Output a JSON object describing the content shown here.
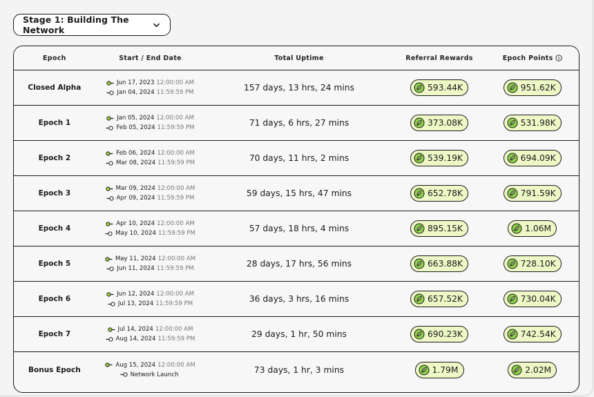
{
  "stage_selector": {
    "label": "Stage 1: Building The Network"
  },
  "table": {
    "headers": {
      "epoch": "Epoch",
      "dates": "Start / End Date",
      "uptime": "Total Uptime",
      "referral": "Referral Rewards",
      "points": "Epoch Points"
    },
    "rows": [
      {
        "epoch": "Closed Alpha",
        "start_date": "Jun 17, 2023",
        "start_time": "12:00:00 AM",
        "end_date": "Jan 04, 2024",
        "end_time": "11:59:59 PM",
        "uptime": "157 days, 13 hrs, 24 mins",
        "referral": "593.44K",
        "points": "951.62K"
      },
      {
        "epoch": "Epoch 1",
        "start_date": "Jan 05, 2024",
        "start_time": "12:00:00 AM",
        "end_date": "Feb 05, 2024",
        "end_time": "11:59:59 PM",
        "uptime": "71 days, 6 hrs, 27 mins",
        "referral": "373.08K",
        "points": "531.98K"
      },
      {
        "epoch": "Epoch 2",
        "start_date": "Feb 06, 2024",
        "start_time": "12:00:00 AM",
        "end_date": "Mar 08, 2024",
        "end_time": "11:59:59 PM",
        "uptime": "70 days, 11 hrs, 2 mins",
        "referral": "539.19K",
        "points": "694.09K"
      },
      {
        "epoch": "Epoch 3",
        "start_date": "Mar 09, 2024",
        "start_time": "12:00:00 AM",
        "end_date": "Apr 09, 2024",
        "end_time": "11:59:59 PM",
        "uptime": "59 days, 15 hrs, 47 mins",
        "referral": "652.78K",
        "points": "791.59K"
      },
      {
        "epoch": "Epoch 4",
        "start_date": "Apr 10, 2024",
        "start_time": "12:00:00 AM",
        "end_date": "May 10, 2024",
        "end_time": "11:59:59 PM",
        "uptime": "57 days, 18 hrs, 4 mins",
        "referral": "895.15K",
        "points": "1.06M"
      },
      {
        "epoch": "Epoch 5",
        "start_date": "May 11, 2024",
        "start_time": "12:00:00 AM",
        "end_date": "Jun 11, 2024",
        "end_time": "11:59:59 PM",
        "uptime": "28 days, 17 hrs, 56 mins",
        "referral": "663.88K",
        "points": "728.10K"
      },
      {
        "epoch": "Epoch 6",
        "start_date": "Jun 12, 2024",
        "start_time": "12:00:00 AM",
        "end_date": "Jul 13, 2024",
        "end_time": "11:59:59 PM",
        "uptime": "36 days, 3 hrs, 16 mins",
        "referral": "657.52K",
        "points": "730.04K"
      },
      {
        "epoch": "Epoch 7",
        "start_date": "Jul 14, 2024",
        "start_time": "12:00:00 AM",
        "end_date": "Aug 14, 2024",
        "end_time": "11:59:59 PM",
        "uptime": "29 days, 1 hr, 50 mins",
        "referral": "690.23K",
        "points": "742.54K"
      },
      {
        "epoch": "Bonus Epoch",
        "start_date": "Aug 15, 2024",
        "start_time": "12:00:00 AM",
        "end_date": "Network Launch",
        "end_time": "",
        "uptime": "73 days, 1 hr, 3 mins",
        "referral": "1.79M",
        "points": "2.02M"
      }
    ]
  },
  "icons": {
    "dropdown": "chevron-down-icon",
    "info": "info-icon",
    "date_start": "start-marker-icon",
    "date_end": "end-marker-icon",
    "reward": "leaf-coin-icon"
  },
  "colors": {
    "pill_background": "#eef8c6",
    "coin_green": "#8fd14f",
    "start_marker": "#a4d843",
    "border": "#1a1a1a"
  }
}
